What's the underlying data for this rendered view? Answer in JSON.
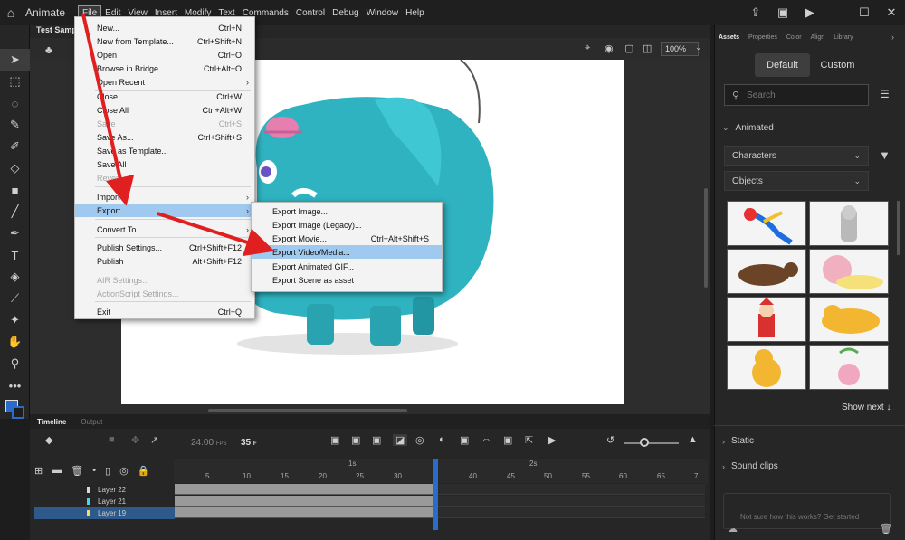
{
  "app": {
    "name": "Animate"
  },
  "menubar": [
    "File",
    "Edit",
    "View",
    "Insert",
    "Modify",
    "Text",
    "Commands",
    "Control",
    "Debug",
    "Window",
    "Help"
  ],
  "document": {
    "tab": "Test Sample",
    "zoom": "100%"
  },
  "file_menu": {
    "items": [
      {
        "label": "New...",
        "shortcut": "Ctrl+N"
      },
      {
        "label": "New from Template...",
        "shortcut": "Ctrl+Shift+N"
      },
      {
        "label": "Open",
        "shortcut": "Ctrl+O"
      },
      {
        "label": "Browse in Bridge",
        "shortcut": "Ctrl+Alt+O"
      },
      {
        "label": "Open Recent",
        "shortcut": ""
      },
      {
        "label": "Close",
        "shortcut": "Ctrl+W"
      },
      {
        "label": "Close All",
        "shortcut": "Ctrl+Alt+W"
      },
      {
        "label": "Save",
        "shortcut": "Ctrl+S"
      },
      {
        "label": "Save As...",
        "shortcut": "Ctrl+Shift+S"
      },
      {
        "label": "Save as Template...",
        "shortcut": ""
      },
      {
        "label": "Save All",
        "shortcut": ""
      },
      {
        "label": "Revert",
        "shortcut": ""
      },
      {
        "label": "Import",
        "shortcut": ""
      },
      {
        "label": "Export",
        "shortcut": ""
      },
      {
        "label": "Convert To",
        "shortcut": ""
      },
      {
        "label": "Publish Settings...",
        "shortcut": "Ctrl+Shift+F12"
      },
      {
        "label": "Publish",
        "shortcut": "Alt+Shift+F12"
      },
      {
        "label": "AIR Settings...",
        "shortcut": ""
      },
      {
        "label": "ActionScript Settings...",
        "shortcut": ""
      },
      {
        "label": "Exit",
        "shortcut": "Ctrl+Q"
      }
    ]
  },
  "export_menu": {
    "items": [
      {
        "label": "Export Image...",
        "shortcut": ""
      },
      {
        "label": "Export Image (Legacy)...",
        "shortcut": ""
      },
      {
        "label": "Export Movie...",
        "shortcut": "Ctrl+Alt+Shift+S"
      },
      {
        "label": "Export Video/Media...",
        "shortcut": ""
      },
      {
        "label": "Export Animated GIF...",
        "shortcut": ""
      },
      {
        "label": "Export Scene as asset",
        "shortcut": ""
      }
    ]
  },
  "timeline": {
    "tabs": [
      "Timeline",
      "Output"
    ],
    "fps": "24.00",
    "fps_unit": "FPS",
    "frame": "35",
    "frame_unit": "F",
    "ruler": [
      "5",
      "10",
      "15",
      "20",
      "25",
      "30",
      "40",
      "45",
      "50",
      "55",
      "60",
      "65",
      "7"
    ],
    "seconds": [
      "1s",
      "2s"
    ],
    "layers": [
      {
        "name": "Layer 22",
        "color": "#d9d9d9"
      },
      {
        "name": "Layer 21",
        "color": "#4fd1e6"
      },
      {
        "name": "Layer 19",
        "color": "#f2e05a"
      }
    ]
  },
  "panel": {
    "tabs": [
      "Assets",
      "Properties",
      "Color",
      "Align",
      "Library"
    ],
    "segments": [
      "Default",
      "Custom"
    ],
    "search_placeholder": "Search",
    "animated": "Animated",
    "characters": "Characters",
    "objects": "Objects",
    "show_next": "Show next",
    "static": "Static",
    "sound_clips": "Sound clips",
    "help_text": "Not sure how this works? Get started"
  },
  "colors": {
    "accent": "#2a6cc9",
    "highlight": "#9fc9ef",
    "arrow": "#e02020",
    "elephant": "#2fb3c0"
  }
}
